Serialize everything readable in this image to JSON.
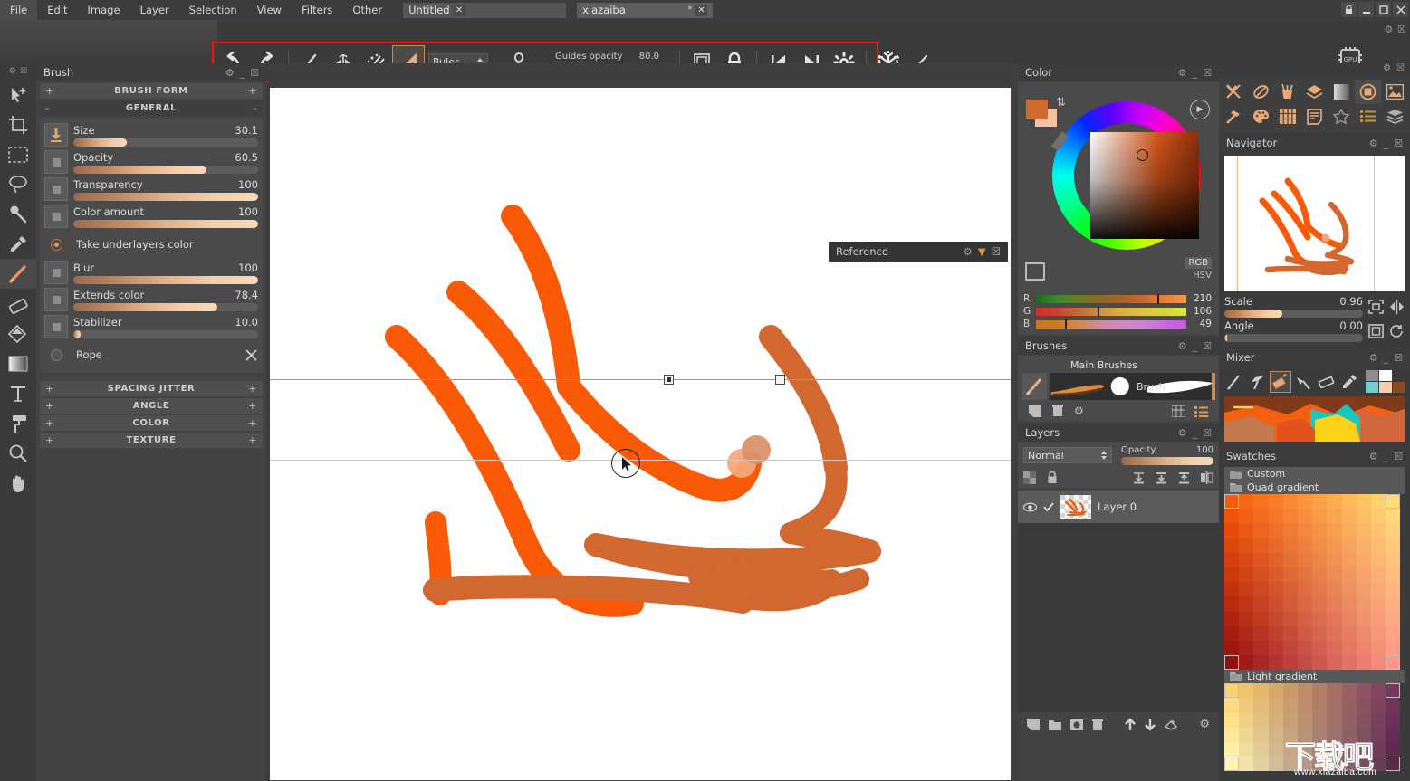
{
  "app": {
    "menus": [
      "File",
      "Edit",
      "Image",
      "Layer",
      "Selection",
      "View",
      "Filters",
      "Other"
    ],
    "documents": [
      {
        "title": "Untitled",
        "close": "✕",
        "modified": ""
      },
      {
        "title": "xiazaiba",
        "close": "✕",
        "modified": "*"
      }
    ],
    "window_controls": [
      "lock",
      "minimize",
      "maximize",
      "close"
    ]
  },
  "options_toolbar": {
    "highlight_color": "#ff1200",
    "buttons": [
      {
        "name": "undo-button",
        "label": "Undo"
      },
      {
        "name": "redo-button",
        "label": "Redo"
      },
      {
        "name": "brush-tool-button",
        "label": "Brush"
      },
      {
        "name": "mirror-button",
        "label": "Mirror"
      },
      {
        "name": "symmetry-button",
        "label": "Symmetry"
      },
      {
        "name": "ruler-button",
        "label": "Ruler",
        "active": true
      }
    ],
    "ruler_select": {
      "value": "Ruler"
    },
    "link_button": "Link guides",
    "guides_opacity": {
      "label": "Guides opacity",
      "value": "80.0",
      "percent": 80
    },
    "right_buttons": [
      {
        "name": "frame-button",
        "label": "Frame"
      },
      {
        "name": "lock-button",
        "label": "Lock"
      },
      {
        "name": "flip-left-button",
        "label": "Flip left"
      },
      {
        "name": "flip-right-button",
        "label": "Flip right"
      },
      {
        "name": "settings-gear-button",
        "label": "Settings"
      },
      {
        "name": "snowflake-button",
        "label": "Snowflake"
      },
      {
        "name": "pen-button",
        "label": "Pen"
      }
    ],
    "gpu_badge": "GPU"
  },
  "toolbox": {
    "items": [
      {
        "name": "move-tool",
        "label": "Move"
      },
      {
        "name": "crop-tool",
        "label": "Crop"
      },
      {
        "name": "rect-select-tool",
        "label": "Rectangular Select"
      },
      {
        "name": "lasso-tool",
        "label": "Lasso"
      },
      {
        "name": "magic-wand-tool",
        "label": "Magic Wand"
      },
      {
        "name": "eyedropper-tool",
        "label": "Color Picker"
      },
      {
        "name": "brush-tool",
        "label": "Brush",
        "selected": true
      },
      {
        "name": "eraser-tool",
        "label": "Eraser"
      },
      {
        "name": "fill-tool",
        "label": "Fill"
      },
      {
        "name": "gradient-tool",
        "label": "Gradient"
      },
      {
        "name": "text-tool",
        "label": "Text"
      },
      {
        "name": "roller-tool",
        "label": "Roller"
      },
      {
        "name": "zoom-tool",
        "label": "Zoom"
      },
      {
        "name": "hand-tool",
        "label": "Hand"
      }
    ]
  },
  "brush_panel": {
    "title": "Brush",
    "sections": [
      {
        "label": "BRUSH FORM",
        "expanded": false,
        "sign": "+"
      },
      {
        "label": "GENERAL",
        "expanded": true,
        "sign": "-"
      }
    ],
    "general": [
      {
        "label": "Size",
        "value": "30.1",
        "percent": 29,
        "icon": "arrow-down-icon"
      },
      {
        "label": "Opacity",
        "value": "60.5",
        "percent": 72,
        "icon": "square-icon"
      },
      {
        "label": "Transparency",
        "value": "100",
        "percent": 100,
        "icon": "square-icon"
      },
      {
        "label": "Color amount",
        "value": "100",
        "percent": 100,
        "icon": "square-icon"
      }
    ],
    "take_underlayers": {
      "label": "Take underlayers color",
      "on": true
    },
    "general2": [
      {
        "label": "Blur",
        "value": "100",
        "percent": 100,
        "icon": "square-icon"
      },
      {
        "label": "Extends color",
        "value": "78.4",
        "percent": 78,
        "icon": "square-icon"
      },
      {
        "label": "Stabilizer",
        "value": "10.0",
        "percent": 4,
        "icon": "square-icon"
      }
    ],
    "rope": {
      "label": "Rope",
      "on": false
    },
    "bottom_sections": [
      {
        "label": "SPACING JITTER",
        "sign": "+"
      },
      {
        "label": "ANGLE",
        "sign": "+"
      },
      {
        "label": "COLOR",
        "sign": "+"
      },
      {
        "label": "TEXTURE",
        "sign": "+"
      }
    ]
  },
  "canvas": {
    "artwork_colors": {
      "bright_orange": "#fa5a05",
      "brown_orange": "#d2682f",
      "light_orange": "#f0a275"
    },
    "guides": [
      {
        "name": "ruler-guide-top"
      },
      {
        "name": "ruler-guide-bottom"
      }
    ],
    "cursor": {
      "name": "brush-cursor"
    }
  },
  "reference_panel": {
    "title": "Reference"
  },
  "color_panel": {
    "title": "Color",
    "mode_rgb": "RGB",
    "mode_hsv": "HSV",
    "foreground": "#d2682f",
    "background": "#f2c3a2",
    "channels": [
      {
        "label": "R",
        "value": "210"
      },
      {
        "label": "G",
        "value": "106"
      },
      {
        "label": "B",
        "value": "49"
      }
    ]
  },
  "brushes_panel": {
    "title": "Brushes",
    "group_label": "Main Brushes",
    "current_brush": "Brush"
  },
  "layers_panel": {
    "title": "Layers",
    "blend_mode": "Normal",
    "opacity_label": "Opacity",
    "opacity_value": "100",
    "layers": [
      {
        "name": "Layer 0",
        "visible": true,
        "checked": true
      }
    ]
  },
  "navigator_panel": {
    "title": "Navigator",
    "scale": {
      "label": "Scale",
      "value": "0.96",
      "percent": 42
    },
    "angle": {
      "label": "Angle",
      "value": "0.00",
      "percent": 2
    }
  },
  "mixer_panel": {
    "title": "Mixer",
    "tools": [
      {
        "name": "mixer-brush-tool",
        "label": "Brush"
      },
      {
        "name": "mixer-knife-tool",
        "label": "Knife"
      },
      {
        "name": "mixer-flat-brush-tool",
        "label": "Flat Brush",
        "active": true
      },
      {
        "name": "mixer-fan-tool",
        "label": "Fan"
      },
      {
        "name": "mixer-eraser-tool",
        "label": "Eraser"
      },
      {
        "name": "mixer-picker-tool",
        "label": "Picker"
      }
    ],
    "mini_swatches": [
      "#8d8d8d",
      "#ffffff",
      "#3a3a3a",
      "#6fd0cf",
      "#f6cdae",
      "#8b4a22"
    ]
  },
  "swatches_panel": {
    "title": "Swatches",
    "groups": [
      {
        "name": "Custom",
        "icon": "folder-icon"
      },
      {
        "name": "Quad gradient",
        "icon": "folder-open-icon"
      },
      {
        "name": "Light gradient",
        "icon": "folder-open-icon"
      }
    ]
  },
  "right_icon_bar": {
    "row1": [
      {
        "name": "tools-icon",
        "label": "Tools"
      },
      {
        "name": "brush-settings-icon",
        "label": "Brush settings"
      },
      {
        "name": "brush-cup-icon",
        "label": "Brushes"
      },
      {
        "name": "layers-icon",
        "label": "Layers"
      },
      {
        "name": "gradient-icon",
        "label": "Gradient"
      },
      {
        "name": "color-wheel-icon",
        "label": "Color"
      },
      {
        "name": "navigator-icon",
        "label": "Navigator"
      }
    ],
    "row2": [
      {
        "name": "hammer-icon",
        "label": "Hammer"
      },
      {
        "name": "palette-icon",
        "label": "Palette"
      },
      {
        "name": "swatches-icon",
        "label": "Swatches"
      },
      {
        "name": "notes-icon",
        "label": "Notes"
      },
      {
        "name": "star-icon",
        "label": "Favorites"
      },
      {
        "name": "list-icon",
        "label": "List"
      },
      {
        "name": "stack-icon",
        "label": "Stack"
      }
    ]
  },
  "watermark": {
    "cn": "下载吧",
    "url": "www.xiazaiba.com"
  }
}
